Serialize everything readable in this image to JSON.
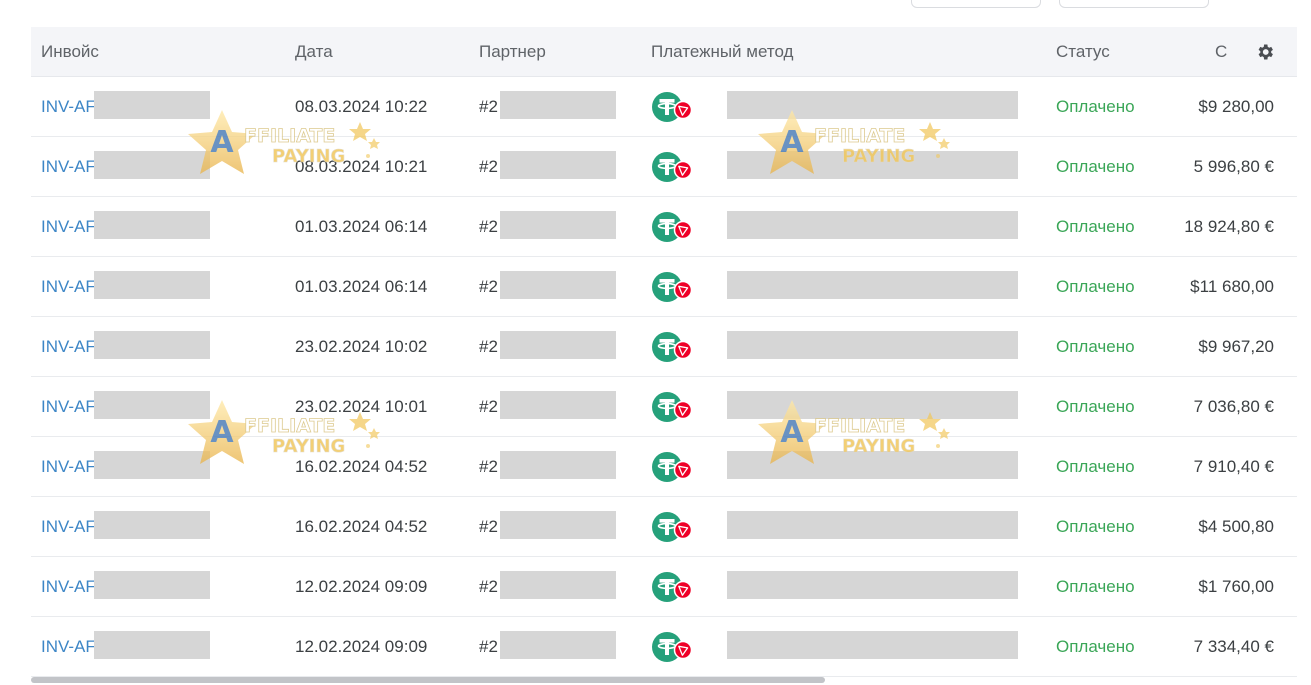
{
  "table": {
    "headers": {
      "invoice": "Инвойс",
      "date": "Дата",
      "partner": "Партнер",
      "method": "Платежный метод",
      "status": "Статус",
      "amount": "С"
    },
    "rows": [
      {
        "invoice": "INV-AF",
        "date": "08.03.2024 10:22",
        "partner": "#2",
        "status": "Оплачено",
        "amount": "$9 280,00"
      },
      {
        "invoice": "INV-AF",
        "date": "08.03.2024 10:21",
        "partner": "#2",
        "status": "Оплачено",
        "amount": "5 996,80 €"
      },
      {
        "invoice": "INV-AF",
        "date": "01.03.2024 06:14",
        "partner": "#2",
        "status": "Оплачено",
        "amount": "18 924,80 €"
      },
      {
        "invoice": "INV-AF",
        "date": "01.03.2024 06:14",
        "partner": "#2",
        "status": "Оплачено",
        "amount": "$11 680,00"
      },
      {
        "invoice": "INV-AF",
        "date": "23.02.2024 10:02",
        "partner": "#2",
        "status": "Оплачено",
        "amount": "$9 967,20"
      },
      {
        "invoice": "INV-AF",
        "date": "23.02.2024 10:01",
        "partner": "#2",
        "status": "Оплачено",
        "amount": "7 036,80 €"
      },
      {
        "invoice": "INV-AF",
        "date": "16.02.2024 04:52",
        "partner": "#2",
        "status": "Оплачено",
        "amount": "7 910,40 €"
      },
      {
        "invoice": "INV-AF",
        "date": "16.02.2024 04:52",
        "partner": "#2",
        "status": "Оплачено",
        "amount": "$4 500,80"
      },
      {
        "invoice": "INV-AF",
        "date": "12.02.2024 09:09",
        "partner": "#2",
        "status": "Оплачено",
        "amount": "$1 760,00"
      },
      {
        "invoice": "INV-AF",
        "date": "12.02.2024 09:09",
        "partner": "#2",
        "status": "Оплачено",
        "amount": "7 334,40 €"
      }
    ]
  },
  "watermark": {
    "line1": "FFILIATE",
    "line2": "PAYING",
    "letter": "A"
  },
  "icons": {
    "settings": "gear-icon",
    "payment_method": "usdt-tron-icon"
  },
  "colors": {
    "link": "#3d86c6",
    "status_paid": "#3aa657",
    "tether": "#26a17b",
    "tron": "#ef0027",
    "header_bg": "#f4f5f8",
    "mask": "#d6d6d6"
  }
}
